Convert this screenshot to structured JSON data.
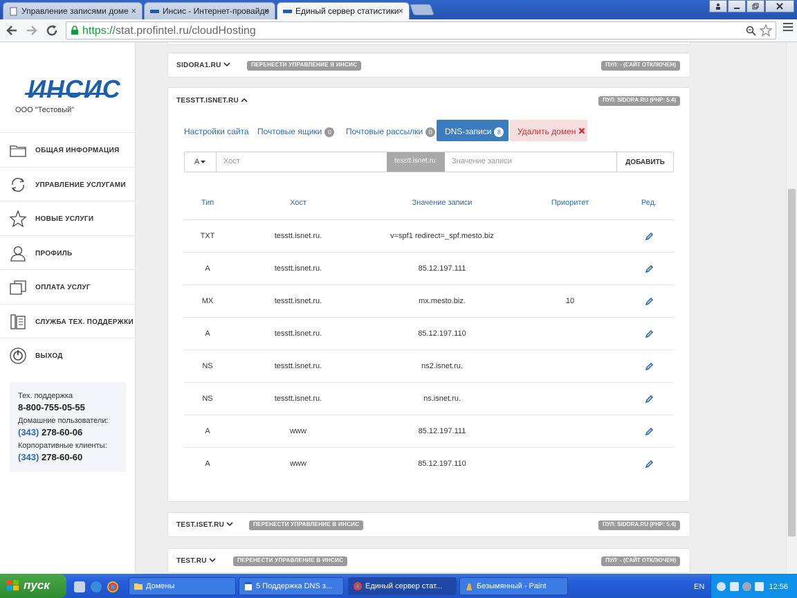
{
  "browser": {
    "tabs": [
      {
        "title": "Управление записями доме",
        "active": false
      },
      {
        "title": "Инсис - Интернет-провайде",
        "active": false
      },
      {
        "title": "Единый сервер статистики",
        "active": true
      }
    ],
    "close_glyph": "×",
    "url_scheme": "https://",
    "url_rest": "stat.profintel.ru/cloudHosting"
  },
  "sidebar": {
    "logo_text": "ИНСИС",
    "company": "ООО \"Тестовый\"",
    "items": [
      {
        "label": "ОБЩАЯ ИНФОРМАЦИЯ",
        "icon": "folder-icon"
      },
      {
        "label": "УПРАВЛЕНИЕ УСЛУГАМИ",
        "icon": "refresh-icon"
      },
      {
        "label": "НОВЫЕ УСЛУГИ",
        "icon": "star-icon"
      },
      {
        "label": "ПРОФИЛЬ",
        "icon": "user-icon"
      },
      {
        "label": "ОПЛАТА УСЛУГ",
        "icon": "payment-icon"
      },
      {
        "label": "СЛУЖБА ТЕХ. ПОДДЕРЖКИ",
        "icon": "phone-icon"
      },
      {
        "label": "ВЫХОД",
        "icon": "power-icon"
      }
    ],
    "support": {
      "tech_label": "Тех. поддержка",
      "tech_phone": "8-800-755-05-55",
      "home_label": "Домашние пользователи:",
      "home_code": "(343)",
      "home_phone": "278-60-06",
      "corp_label": "Корпоративные клиенты:",
      "corp_code": "(343)",
      "corp_phone": "278-60-60"
    }
  },
  "domains": {
    "sidora": {
      "name": "SIDORA1.RU",
      "transfer": "ПЕРЕНЕСТИ УПРАВЛЕНИЕ В ИНСИС",
      "pool": "ПУЛ: - (САЙТ ОТКЛЮЧЕН)"
    },
    "tesstt": {
      "name": "TESSTT.ISNET.RU",
      "pool": "ПУЛ: SIDORA.RU (PHP: 5.4)"
    },
    "testiset": {
      "name": "TEST.ISET.RU",
      "transfer": "ПЕРЕНЕСТИ УПРАВЛЕНИЕ В ИНСИС",
      "pool": "ПУЛ: SIDORA.RU (PHP: 5.4)"
    },
    "test": {
      "name": "TEST.RU",
      "transfer": "ПЕРЕНЕСТИ УПРАВЛЕНИЕ В ИНСИС",
      "pool": "ПУЛ: - (САЙТ ОТКЛЮЧЕН)"
    }
  },
  "tabs": {
    "site_settings": "Настройки сайта",
    "mailboxes": "Почтовые ящики",
    "mailboxes_count": "0",
    "mailings": "Почтовые рассылки",
    "mailings_count": "0",
    "dns": "DNS-записи",
    "dns_count": "8",
    "delete": "Удалить домен"
  },
  "form": {
    "type_value": "A",
    "host_placeholder": "Хост",
    "suffix": "tesstt.isnet.ru",
    "value_placeholder": "Значение записи",
    "add_label": "ДОБАВИТЬ"
  },
  "table": {
    "headers": [
      "Тип",
      "Хост",
      "Значение записи",
      "Приоритет",
      "Ред."
    ],
    "rows": [
      [
        "TXT",
        "tesstt.isnet.ru.",
        "v=spf1 redirect=_spf.mesto.biz",
        ""
      ],
      [
        "A",
        "tesstt.isnet.ru.",
        "85.12.197.111",
        ""
      ],
      [
        "MX",
        "tesstt.isnet.ru.",
        "mx.mesto.biz.",
        "10"
      ],
      [
        "A",
        "tesstt.isnet.ru.",
        "85.12.197.110",
        ""
      ],
      [
        "NS",
        "tesstt.isnet.ru.",
        "ns2.isnet.ru.",
        ""
      ],
      [
        "NS",
        "tesstt.isnet.ru.",
        "ns.isnet.ru.",
        ""
      ],
      [
        "A",
        "www",
        "85.12.197.111",
        ""
      ],
      [
        "A",
        "www",
        "85.12.197.110",
        ""
      ]
    ]
  },
  "taskbar": {
    "start": "пуск",
    "tasks": [
      "Домены",
      "5 Поддержка DNS з...",
      "Единый сервер стат...",
      "Безымянный - Paint"
    ],
    "lang": "EN",
    "clock": "12:56"
  },
  "colors": {
    "accent": "#3c7dc0",
    "link": "#2b6ab0",
    "danger": "#c0303a",
    "badge": "#9a9a9a"
  }
}
